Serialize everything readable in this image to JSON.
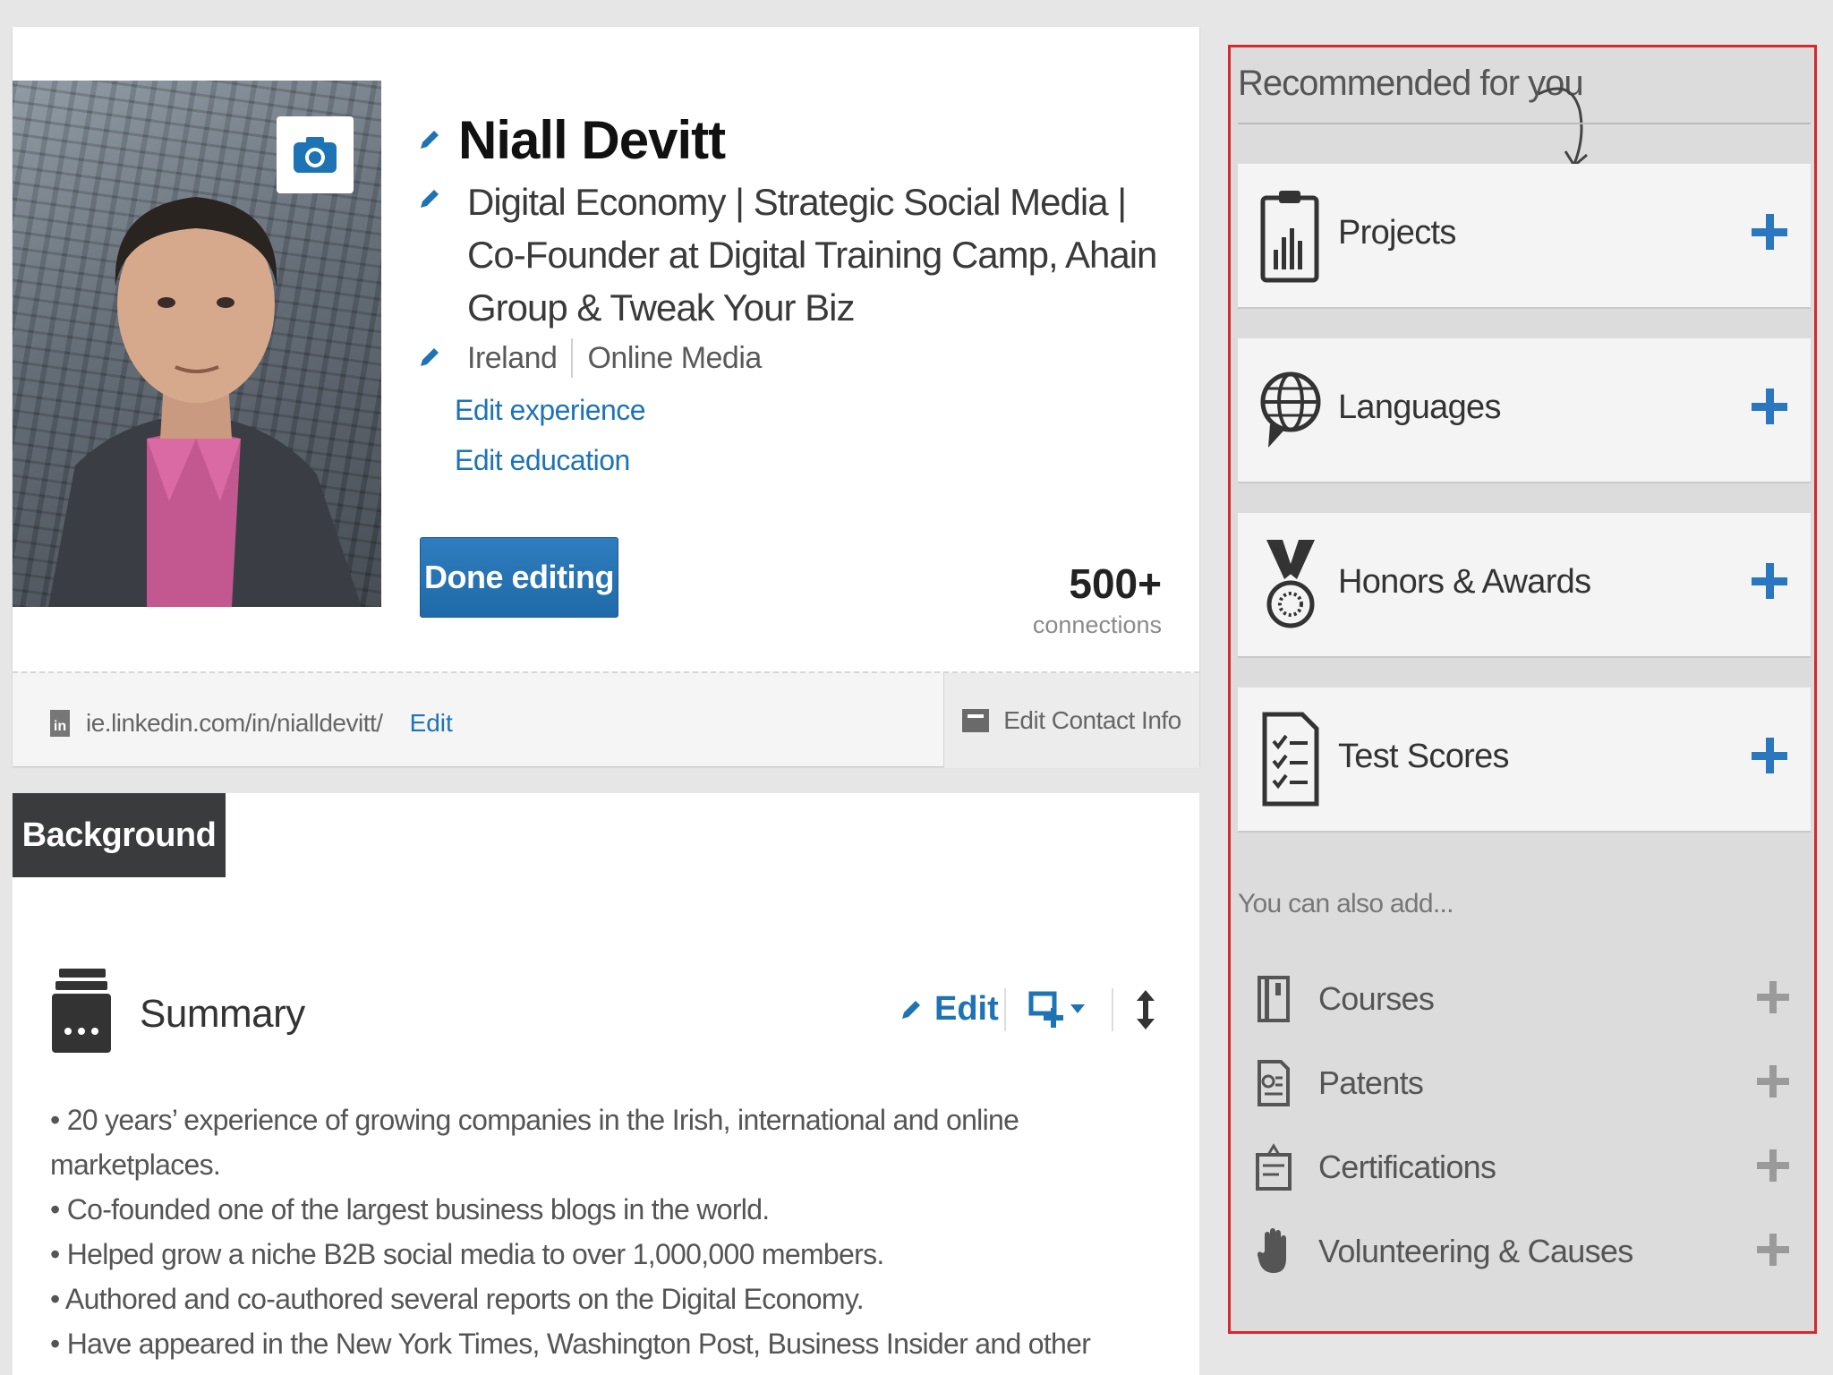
{
  "profile": {
    "name": "Niall Devitt",
    "headline": "Digital Economy | Strategic Social Media | Co-Founder at Digital Training Camp, Ahain Group & Tweak Your Biz",
    "location": "Ireland",
    "industry": "Online Media",
    "edit_experience": "Edit experience",
    "edit_education": "Edit education",
    "done_button": "Done editing",
    "connections_count": "500+",
    "connections_label": "connections",
    "public_url": "ie.linkedin.com/in/nialldevitt/",
    "url_edit": "Edit",
    "edit_contact": "Edit Contact Info"
  },
  "background": {
    "tab_label": "Background",
    "summary_title": "Summary",
    "summary_edit": "Edit",
    "bullets": [
      "• 20 years’ experience of growing companies in the Irish, international and online marketplaces.",
      "• Co-founded one of the largest business blogs in the world.",
      "• Helped grow a niche B2B social media to over 1,000,000 members.",
      "• Authored and co-authored several reports on the Digital Economy.",
      "• Have appeared in the New York Times, Washington Post, Business Insider and other leading online and offline business publications."
    ]
  },
  "recommended": {
    "title": "Recommended for you",
    "items": [
      {
        "label": "Projects",
        "icon": "clipboard-chart-icon"
      },
      {
        "label": "Languages",
        "icon": "globe-speech-icon"
      },
      {
        "label": "Honors & Awards",
        "icon": "medal-icon"
      },
      {
        "label": "Test Scores",
        "icon": "checklist-icon"
      }
    ],
    "also_add_label": "You can also add...",
    "also_items": [
      {
        "label": "Courses",
        "icon": "book-icon"
      },
      {
        "label": "Patents",
        "icon": "patent-document-icon"
      },
      {
        "label": "Certifications",
        "icon": "certificate-icon"
      },
      {
        "label": "Volunteering & Causes",
        "icon": "hand-icon"
      }
    ]
  },
  "colors": {
    "accent_blue": "#1e73b4",
    "highlight_red": "#d9272e",
    "dark_tab": "#3a3b3d"
  }
}
